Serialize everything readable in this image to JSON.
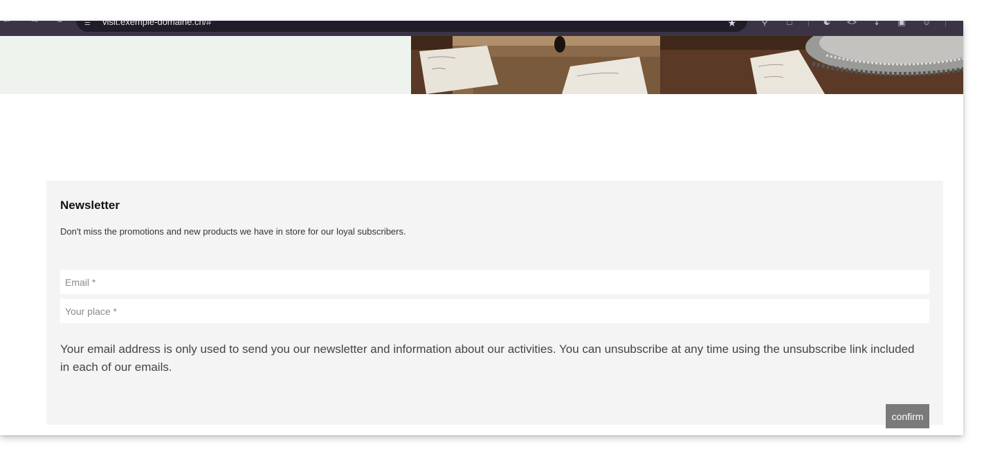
{
  "browser": {
    "url": "visit.exemple-domaine.ch/#",
    "back_icon": "arrow-left-icon",
    "forward_icon": "arrow-right-icon",
    "reload_icon": "reload-icon",
    "site_info_icon": "tune-icon",
    "bookmark_icon": "star-icon",
    "toolbar_icons": [
      "zoom-icon",
      "save-icon",
      "translate-icon",
      "code-icon",
      "download-icon",
      "tab-icon",
      "profile-icon"
    ],
    "chrome_color": "#3b3447"
  },
  "hero": {
    "left_color": "#eef3ee",
    "photo_icon": "photo-icon"
  },
  "newsletter": {
    "title": "Newsletter",
    "intro": "Don't miss the promotions and new products we have in store for our loyal subscribers.",
    "email_placeholder": "Email *",
    "place_placeholder": "Your place *",
    "notice": "Your email address is only used to send you our newsletter and information about our activities. You can unsubscribe at any time using the unsubscribe link included in each of our emails.",
    "confirm_label": "confirm",
    "background": "#f4f4f4",
    "button_color": "#7a7a7a"
  }
}
